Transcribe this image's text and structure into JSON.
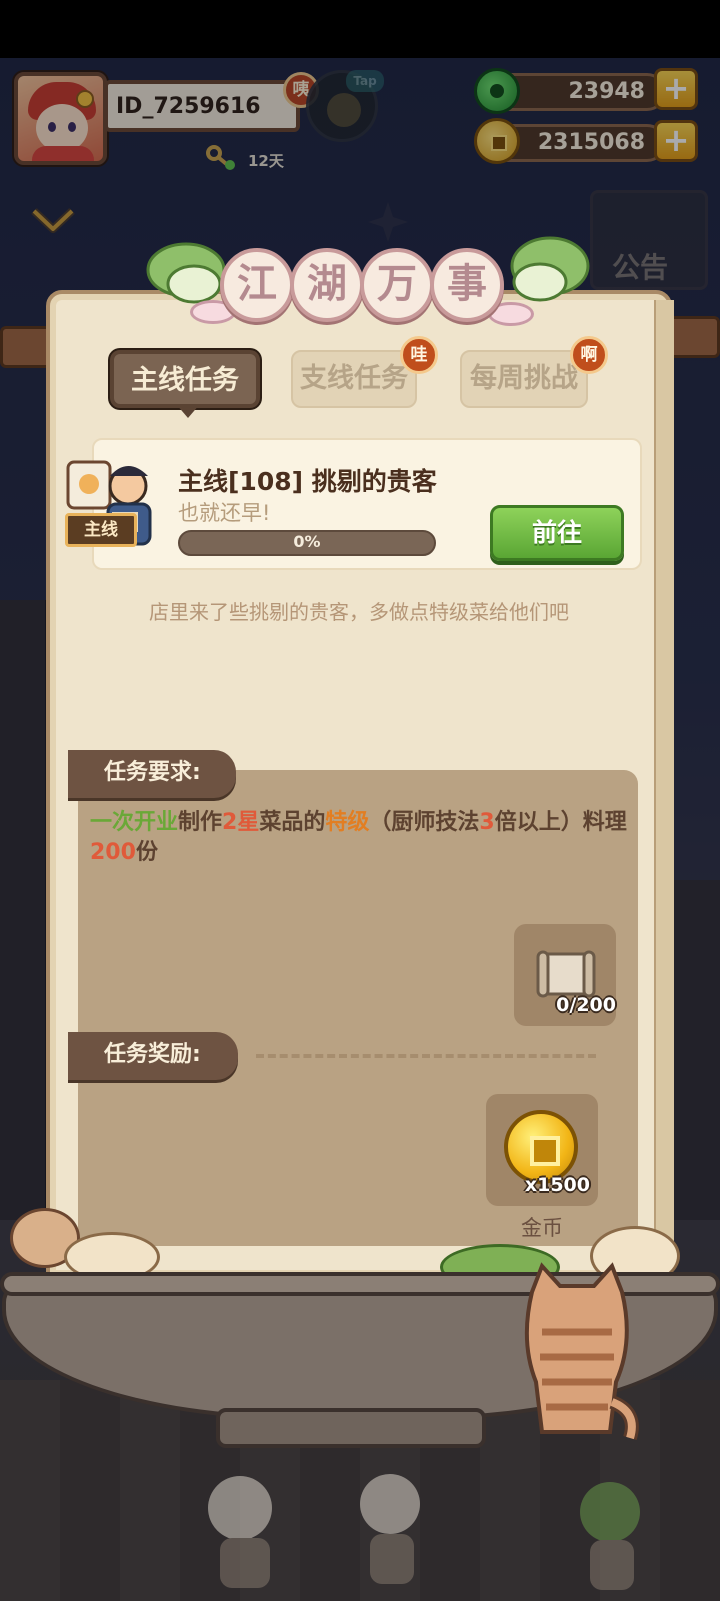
{
  "player": {
    "id": "ID_7259616",
    "badge": "咦",
    "tap_label": "Tap",
    "days": "12天"
  },
  "resources": {
    "jade": "23948",
    "coins": "2315068",
    "plus_label": "+"
  },
  "notice": {
    "text": "公告"
  },
  "panel": {
    "title_chars": [
      "江",
      "湖",
      "万",
      "事"
    ]
  },
  "tabs": [
    {
      "label": "主线任务",
      "active": true
    },
    {
      "label": "支线任务",
      "active": false,
      "badge": "哇"
    },
    {
      "label": "每周挑战",
      "active": false,
      "badge": "啊"
    }
  ],
  "quest": {
    "tag": "主线",
    "title": "主线[108] 挑剔的贵客",
    "subtitle": "也就还早!",
    "progress_text": "0%",
    "progress_fraction": 0.0,
    "go_label": "前往",
    "description": "店里来了些挑剔的贵客，多做点特级菜给他们吧"
  },
  "requirement": {
    "label": "任务要求:",
    "segments": [
      {
        "text": "一次开业",
        "style": "green"
      },
      {
        "text": "制作",
        "style": "normal"
      },
      {
        "text": "2星",
        "style": "red"
      },
      {
        "text": "菜品的",
        "style": "normal"
      },
      {
        "text": "特级",
        "style": "orange"
      },
      {
        "text": "（厨师技法",
        "style": "normal"
      },
      {
        "text": "3",
        "style": "red"
      },
      {
        "text": "倍以上）料理",
        "style": "normal"
      },
      {
        "text": "200",
        "style": "red"
      },
      {
        "text": "份",
        "style": "normal"
      }
    ],
    "item_count": "0/200",
    "item_icon": "scroll-icon"
  },
  "reward": {
    "label": "任务奖励:",
    "item_count": "x1500",
    "item_name": "金币",
    "item_icon": "gold-coin-icon"
  },
  "colors": {
    "accent_green": "#6aa837",
    "highlight_red": "#e05a3a",
    "highlight_orange": "#e27e22",
    "panel_bg": "#efe4cc",
    "tab_active": "#7b6452"
  }
}
